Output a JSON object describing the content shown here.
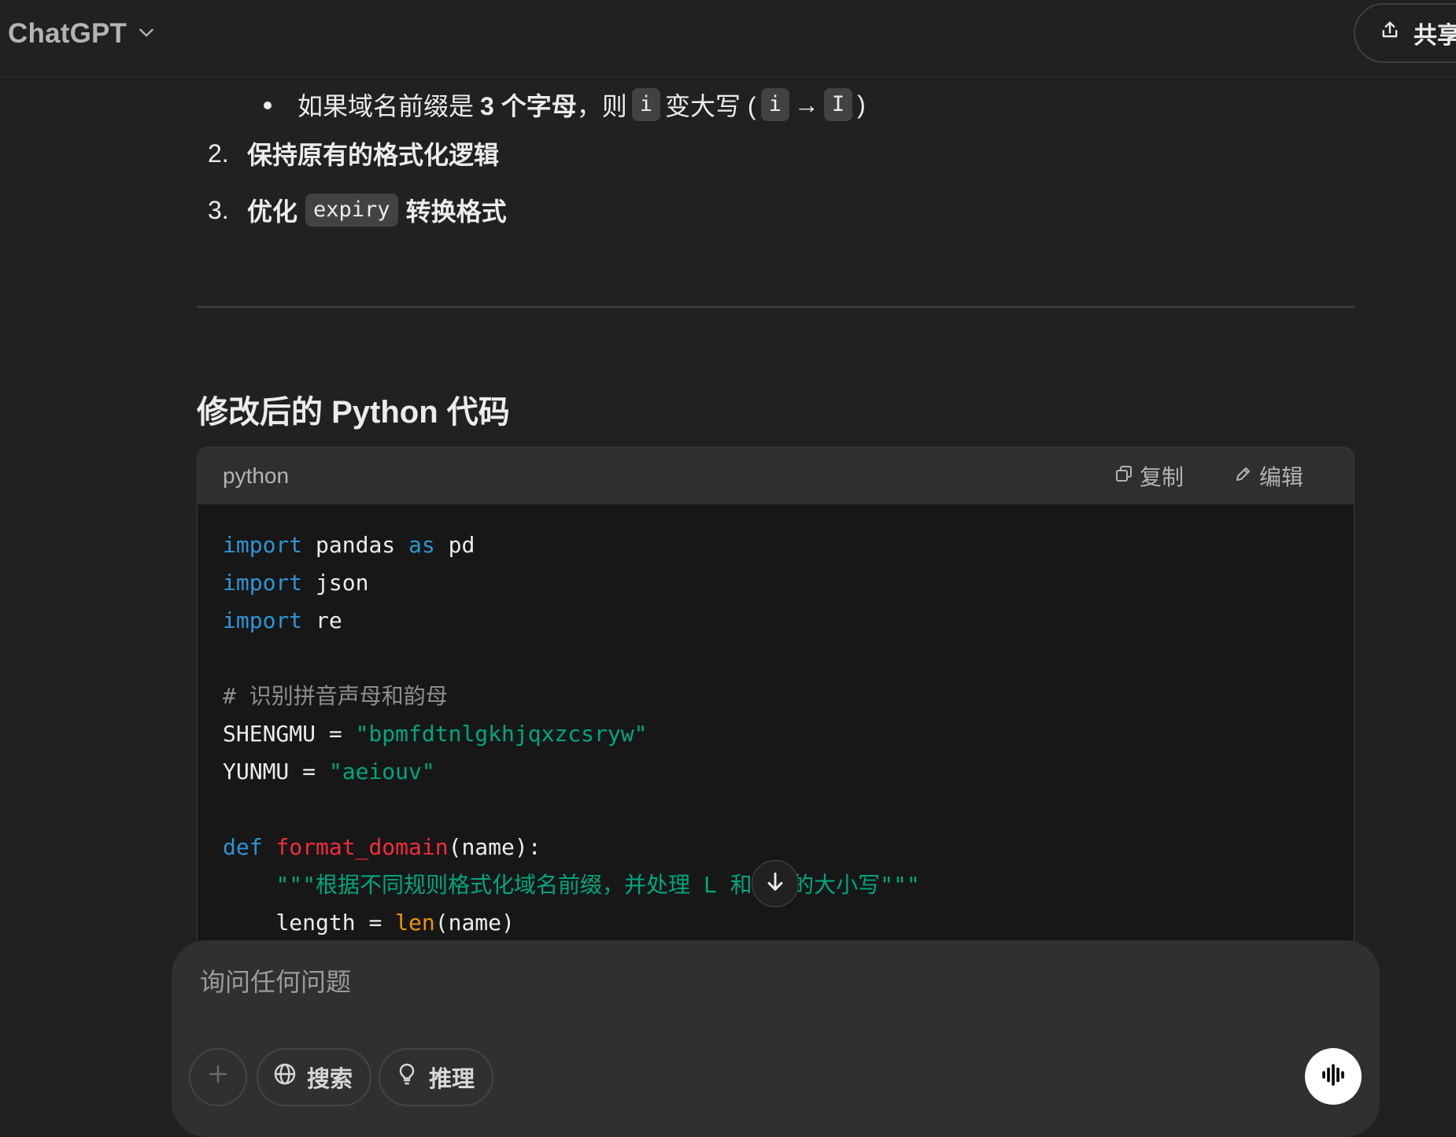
{
  "header": {
    "model_label": "ChatGPT",
    "share_label": "共享"
  },
  "message": {
    "bullet": {
      "part1": "如果域名前缀是",
      "bold": "3 个字母",
      "part2": "，则",
      "chip1": "i",
      "part3": "变大写 (",
      "chip2": "i",
      "arrow": "→",
      "chip3": "I",
      "part4": ")"
    },
    "list": [
      {
        "num": "2.",
        "text": "保持原有的格式化逻辑"
      },
      {
        "num": "3.",
        "text_before": "优化",
        "chip": "expiry",
        "text_after": "转换格式"
      }
    ],
    "section_heading": "修改后的 Python 代码"
  },
  "code_block": {
    "language": "python",
    "copy_label": "复制",
    "edit_label": "编辑",
    "lines": {
      "l1": {
        "kw1": "import",
        "t1": " pandas ",
        "kw2": "as",
        "t2": " pd"
      },
      "l2": {
        "kw": "import",
        "t": " json"
      },
      "l3": {
        "kw": "import",
        "t": " re"
      },
      "l5": "# 识别拼音声母和韵母",
      "l6": {
        "name": "SHENGMU = ",
        "str": "\"bpmfdtnlgkhjqxzcsryw\""
      },
      "l7": {
        "name": "YUNMU = ",
        "str": "\"aeiouv\""
      },
      "l9": {
        "kw": "def",
        "sp": " ",
        "fn": "format_domain",
        "args": "(name):"
      },
      "l10": {
        "indent": "    ",
        "doc": "\"\"\"根据不同规则格式化域名前缀，并处理 L 和 i 的大小写\"\"\""
      },
      "l11": {
        "indent": "    ",
        "t1": "length = ",
        "bi": "len",
        "t2": "(name)"
      }
    }
  },
  "composer": {
    "placeholder": "询问任何问题",
    "search_label": "搜索",
    "reason_label": "推理"
  }
}
